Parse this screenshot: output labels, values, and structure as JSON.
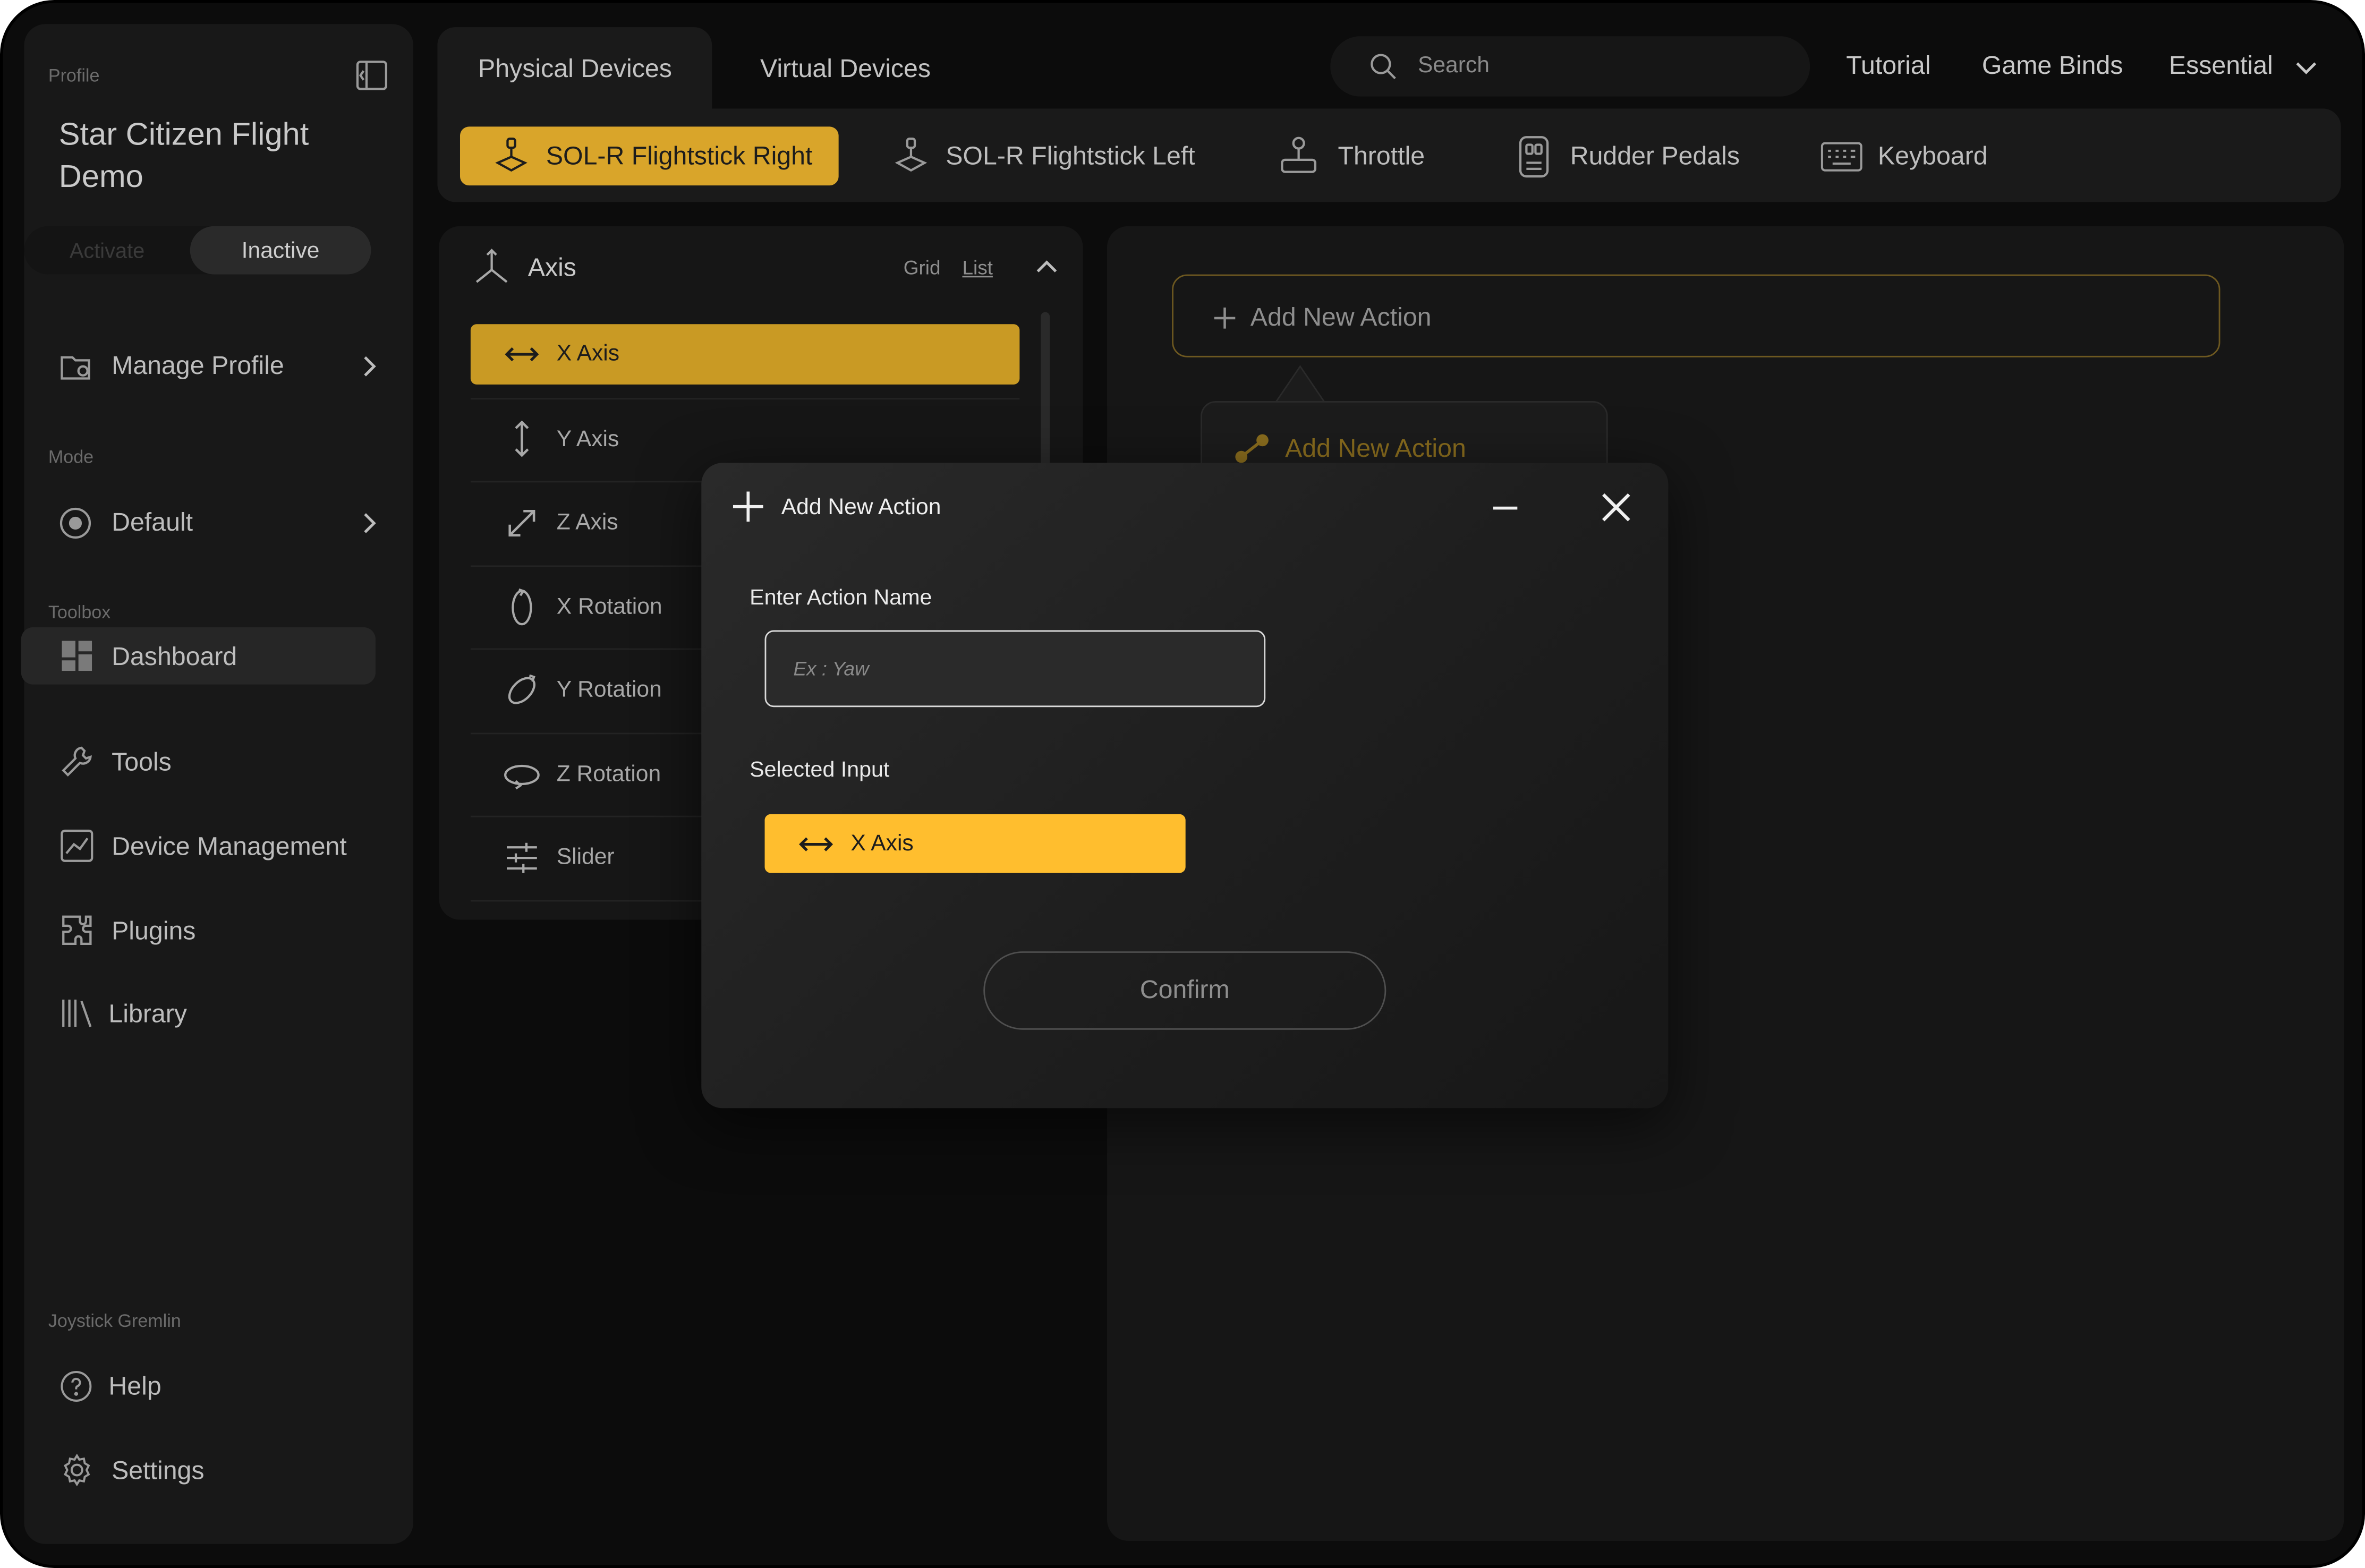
{
  "sidebar": {
    "profile_label": "Profile",
    "profile_name": "Star Citizen Flight Demo",
    "activate_label": "Activate",
    "inactive_label": "Inactive",
    "manage_profile": "Manage Profile",
    "mode_label": "Mode",
    "mode_value": "Default",
    "toolbox_label": "Toolbox",
    "items": [
      {
        "label": "Dashboard",
        "icon": "dashboard-icon"
      },
      {
        "label": "Tools",
        "icon": "wrench-icon"
      },
      {
        "label": "Device Management",
        "icon": "chart-icon"
      },
      {
        "label": "Plugins",
        "icon": "puzzle-icon"
      },
      {
        "label": "Library",
        "icon": "library-icon"
      }
    ],
    "footer_label": "Joystick Gremlin",
    "help": "Help",
    "settings": "Settings"
  },
  "topbar": {
    "tabs": [
      "Physical Devices",
      "Virtual Devices"
    ],
    "search_placeholder": "Search",
    "links": [
      "Tutorial",
      "Game Binds",
      "Essential"
    ]
  },
  "devices": [
    {
      "label": "SOL-R Flightstick Right",
      "icon": "joystick-icon"
    },
    {
      "label": "SOL-R Flightstick Left",
      "icon": "joystick-icon"
    },
    {
      "label": "Throttle",
      "icon": "throttle-icon"
    },
    {
      "label": "Rudder Pedals",
      "icon": "pedals-icon"
    },
    {
      "label": "Keyboard",
      "icon": "keyboard-icon"
    }
  ],
  "axis_panel": {
    "title": "Axis",
    "view_grid": "Grid",
    "view_list": "List",
    "items": [
      "X Axis",
      "Y Axis",
      "Z Axis",
      "X Rotation",
      "Y Rotation",
      "Z Rotation",
      "Slider"
    ]
  },
  "right_pane": {
    "add_action": "Add New Action",
    "ghost_action": "Add New Action"
  },
  "modal": {
    "title": "Add New Action",
    "name_label": "Enter Action Name",
    "name_placeholder": "Ex : Yaw",
    "name_value": "",
    "selected_label": "Selected Input",
    "selected_value": "X Axis",
    "confirm": "Confirm"
  },
  "colors": {
    "accent": "#ffbe2e",
    "accent_dim": "#d9a52a",
    "background": "#0c0c0c",
    "panel": "#181818"
  }
}
